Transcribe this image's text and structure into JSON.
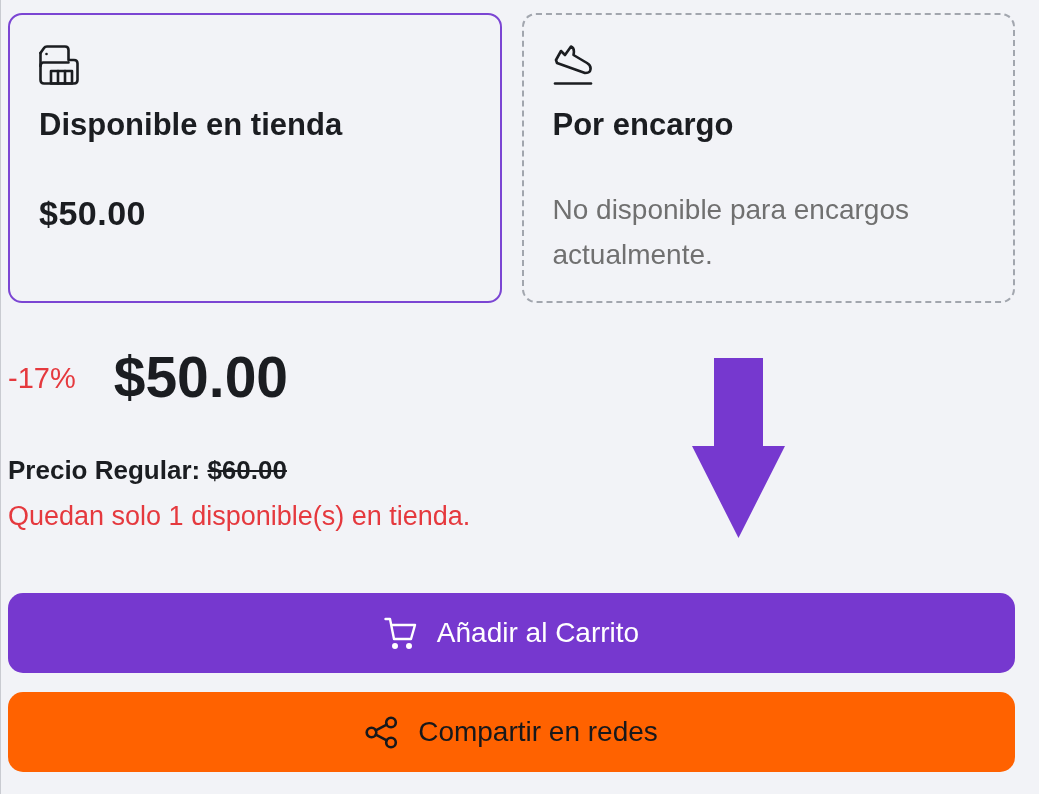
{
  "fulfillment_options": [
    {
      "kind": "store",
      "title": "Disponible en tienda",
      "price": "$50.00",
      "selected": true
    },
    {
      "kind": "order",
      "title": "Por encargo",
      "note": "No disponible para encargos actualmente.",
      "selected": false
    }
  ],
  "pricing": {
    "discount": "-17%",
    "price": "$50.00",
    "regular_price_label": "Precio Regular:",
    "regular_price": "$60.00",
    "stock_note": "Quedan solo 1 disponible(s) en tienda."
  },
  "actions": [
    {
      "kind": "cart",
      "label": "Añadir al Carrito"
    },
    {
      "kind": "share",
      "label": "Compartir en redes"
    }
  ]
}
